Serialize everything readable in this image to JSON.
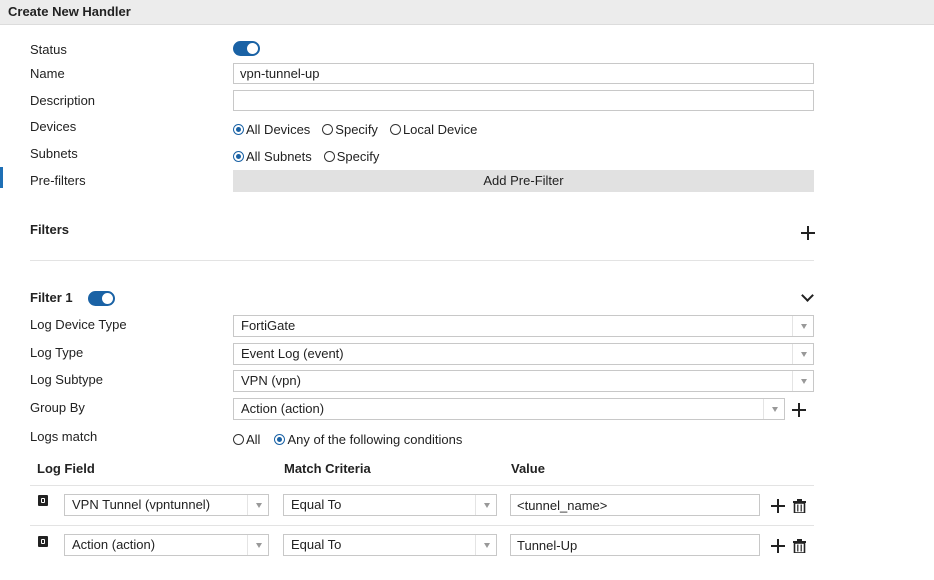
{
  "header": {
    "title": "Create New Handler"
  },
  "form": {
    "status_label": "Status",
    "status_on": true,
    "name_label": "Name",
    "name_value": "vpn-tunnel-up",
    "description_label": "Description",
    "description_value": "",
    "devices_label": "Devices",
    "devices_options": [
      "All Devices",
      "Specify",
      "Local Device"
    ],
    "devices_selected": "All Devices",
    "subnets_label": "Subnets",
    "subnets_options": [
      "All Subnets",
      "Specify"
    ],
    "subnets_selected": "All Subnets",
    "prefilters_label": "Pre-filters",
    "add_prefilter_label": "Add Pre-Filter"
  },
  "filters": {
    "section_label": "Filters",
    "filter1": {
      "title": "Filter 1",
      "enabled": true,
      "log_device_type_label": "Log Device Type",
      "log_device_type_value": "FortiGate",
      "log_type_label": "Log Type",
      "log_type_value": "Event Log (event)",
      "log_subtype_label": "Log Subtype",
      "log_subtype_value": "VPN (vpn)",
      "group_by_label": "Group By",
      "group_by_value": "Action (action)",
      "logs_match_label": "Logs match",
      "logs_match_options": [
        "All",
        "Any of the following conditions"
      ],
      "logs_match_selected": "Any of the following conditions",
      "table": {
        "headers": [
          "Log Field",
          "Match Criteria",
          "Value"
        ],
        "rows": [
          {
            "field": "VPN Tunnel (vpntunnel)",
            "criteria": "Equal To",
            "value": "<tunnel_name>"
          },
          {
            "field": "Action (action)",
            "criteria": "Equal To",
            "value": "Tunnel-Up"
          }
        ]
      }
    }
  },
  "icons": {
    "add": "plus-icon",
    "delete": "trash-icon",
    "collapse": "chevron-down-icon",
    "row": "item-icon"
  },
  "colors": {
    "accent": "#1a62a5",
    "header_bg": "#ececec",
    "button_bg": "#e1e1e1"
  }
}
